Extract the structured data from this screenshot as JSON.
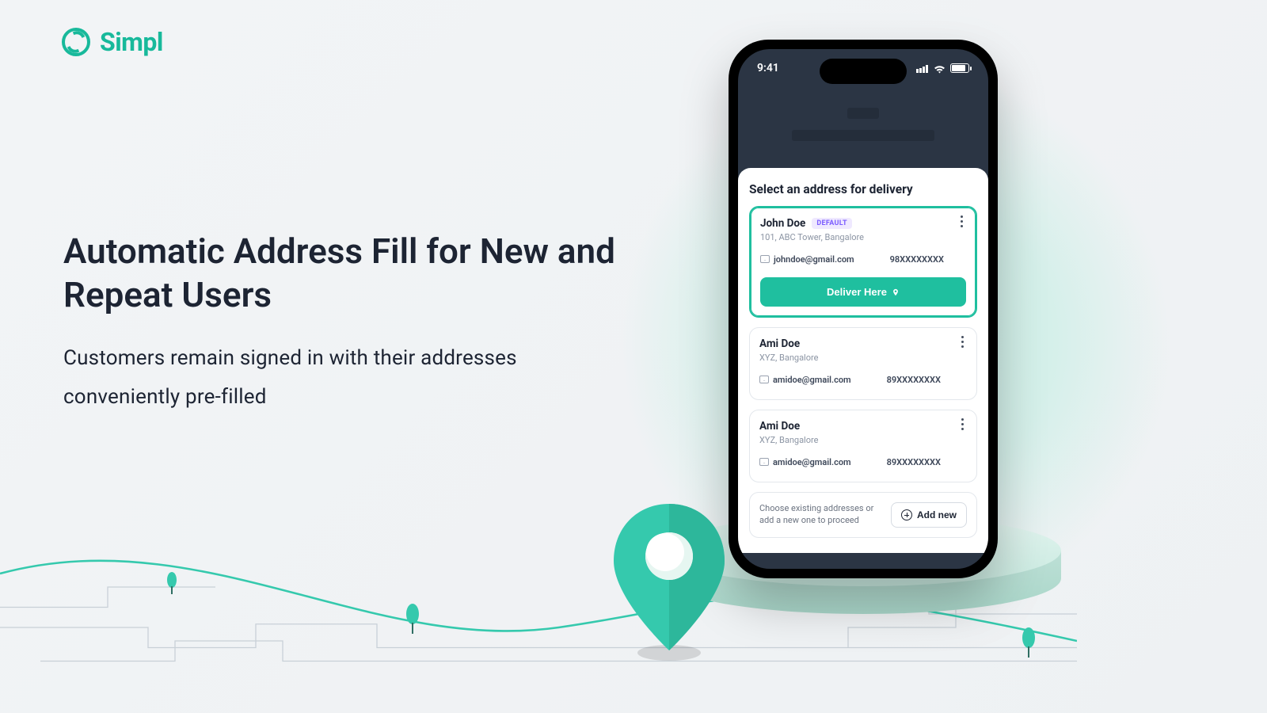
{
  "brand": {
    "name": "Simpl"
  },
  "hero": {
    "headline": "Automatic Address Fill for New and Repeat Users",
    "subhead": "Customers remain signed in with their addresses conveniently pre-filled"
  },
  "phone": {
    "time": "9:41",
    "sheet_title": "Select an address for delivery",
    "deliver_label": "Deliver Here",
    "default_badge": "DEFAULT",
    "addresses": [
      {
        "name": "John Doe",
        "is_default": true,
        "address": "101, ABC Tower, Bangalore",
        "email": "johndoe@gmail.com",
        "phone": "98XXXXXXXX",
        "selected": true
      },
      {
        "name": "Ami Doe",
        "is_default": false,
        "address": "XYZ, Bangalore",
        "email": "amidoe@gmail.com",
        "phone": "89XXXXXXXX",
        "selected": false
      },
      {
        "name": "Ami Doe",
        "is_default": false,
        "address": "XYZ, Bangalore",
        "email": "amidoe@gmail.com",
        "phone": "89XXXXXXXX",
        "selected": false
      }
    ],
    "footer_text": "Choose existing addresses or add a new one to proceed",
    "add_new_label": "Add new"
  },
  "colors": {
    "brand": "#1fbf9f",
    "ink": "#1d2433",
    "badge_fg": "#7b5cff",
    "badge_bg": "#efe9ff"
  }
}
